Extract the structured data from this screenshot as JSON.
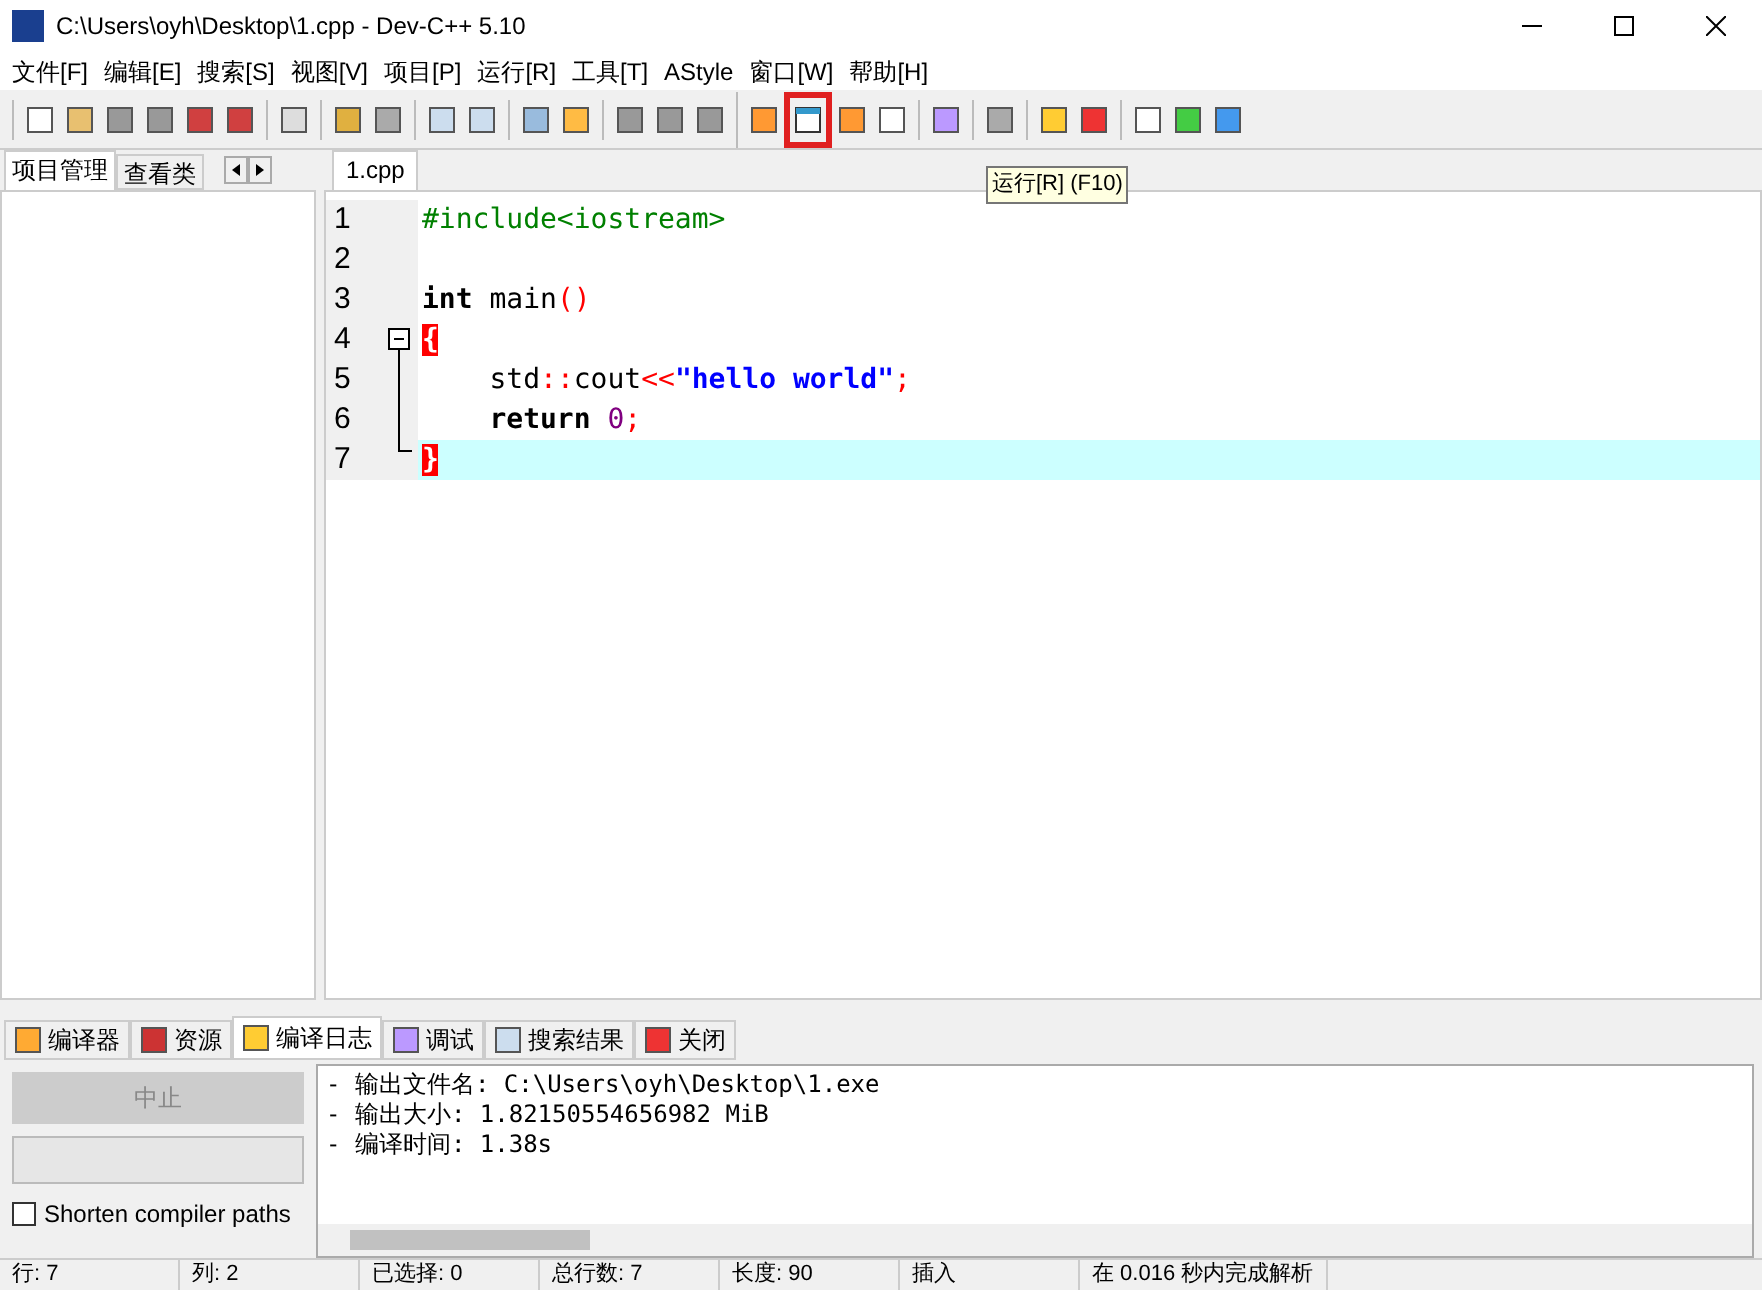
{
  "window": {
    "title": "C:\\Users\\oyh\\Desktop\\1.cpp - Dev-C++ 5.10"
  },
  "menu": [
    "文件[F]",
    "编辑[E]",
    "搜索[S]",
    "视图[V]",
    "项目[P]",
    "运行[R]",
    "工具[T]",
    "AStyle",
    "窗口[W]",
    "帮助[H]"
  ],
  "tooltip": "运行[R] (F10)",
  "left_tabs": [
    {
      "label": "项目管理",
      "selected": true
    },
    {
      "label": "查看类",
      "selected": false
    }
  ],
  "editor_tabs": [
    {
      "label": "1.cpp",
      "selected": true
    }
  ],
  "code": [
    {
      "num": "1",
      "tokens": [
        {
          "kind": "pre",
          "text": "#include<iostream>"
        }
      ],
      "current": false
    },
    {
      "num": "2",
      "current": false
    },
    {
      "num": "3",
      "tokens": [
        {
          "kind": "kw",
          "text": "int"
        },
        {
          "kind": "id",
          "text": " main"
        },
        {
          "kind": "op",
          "text": "()"
        }
      ],
      "current": false
    },
    {
      "num": "4",
      "tokens": [
        {
          "kind": "brace",
          "text": "{"
        }
      ],
      "current": false
    },
    {
      "num": "5",
      "tokens": [
        {
          "kind": "id",
          "text": "    std"
        },
        {
          "kind": "op",
          "text": "::"
        },
        {
          "kind": "id",
          "text": "cout"
        },
        {
          "kind": "op",
          "text": "<<"
        },
        {
          "kind": "str",
          "text": "\"hello world\""
        },
        {
          "kind": "op",
          "text": ";"
        }
      ],
      "current": false
    },
    {
      "num": "6",
      "tokens": [
        {
          "kind": "kw",
          "text": "    return"
        },
        {
          "kind": "num",
          "text": " 0"
        },
        {
          "kind": "op",
          "text": ";"
        }
      ],
      "current": false
    },
    {
      "num": "7",
      "tokens": [
        {
          "kind": "brace",
          "text": "}"
        }
      ],
      "current": true
    }
  ],
  "bottom_tabs": [
    {
      "label": "编译器",
      "selected": false
    },
    {
      "label": "资源",
      "selected": false
    },
    {
      "label": "编译日志",
      "selected": true
    },
    {
      "label": "调试",
      "selected": false
    },
    {
      "label": "搜索结果",
      "selected": false
    },
    {
      "label": "关闭",
      "selected": false
    }
  ],
  "abort_button": {
    "label": "中止",
    "disabled": true
  },
  "progress": {
    "level": 0
  },
  "shorten_paths": {
    "label": "Shorten compiler paths",
    "checked": false
  },
  "log": [
    "- 输出文件名: C:\\Users\\oyh\\Desktop\\1.exe",
    "- 输出大小: 1.82150554656982 MiB",
    "- 编译时间: 1.38s"
  ],
  "status_bar": [
    "行: 7",
    "列: 2",
    "已选择: 0",
    "总行数: 7",
    "长度: 90",
    "插入",
    "在 0.016 秒内完成解析"
  ]
}
